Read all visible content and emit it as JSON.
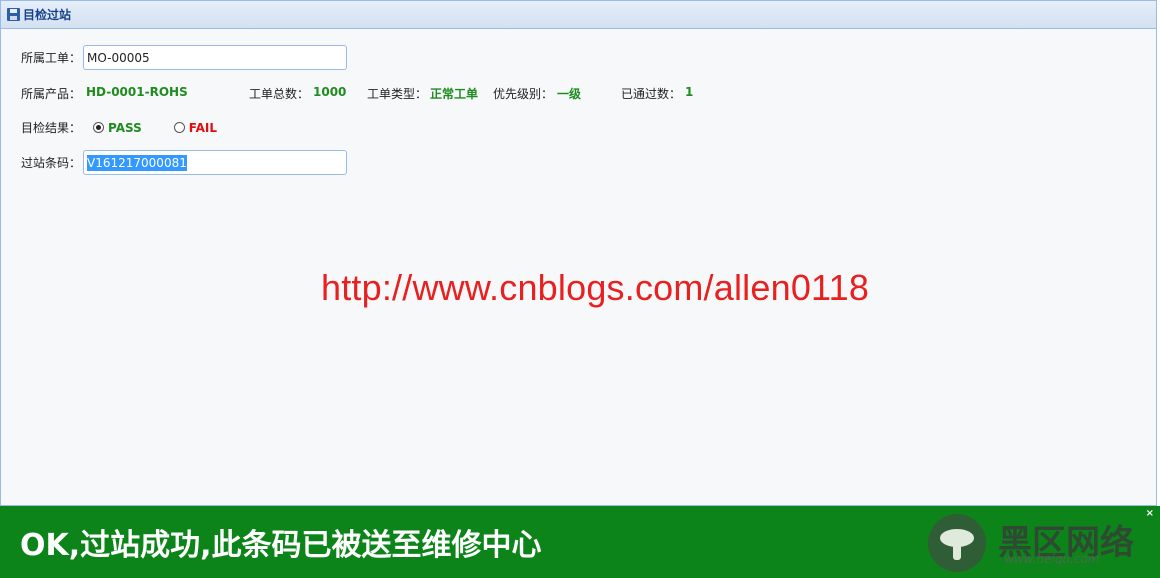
{
  "panel": {
    "title": "目检过站",
    "icon": "save-icon"
  },
  "form": {
    "work_order_label": "所属工单：",
    "work_order_value": "MO-00005",
    "product_label": "所属产品：",
    "product_value": "HD-0001-ROHS",
    "total_label": "工单总数：",
    "total_value": "1000",
    "type_label": "工单类型：",
    "type_value": "正常工单",
    "priority_label": "优先级别：",
    "priority_value": "一级",
    "passed_label": "已通过数：",
    "passed_value": "1",
    "result_label": "目检结果：",
    "pass_label": "PASS",
    "fail_label": "FAIL",
    "pass_checked": true,
    "barcode_label": "过站条码：",
    "barcode_value": "V161217000081"
  },
  "watermark": {
    "url": "http://www.cnblogs.com/allen0118"
  },
  "toast": {
    "message": "OK,过站成功,此条码已被送至维修中心",
    "close": "×"
  },
  "logo": {
    "text": "黑区网络",
    "sub": "www.heiqu.com"
  },
  "colors": {
    "success_green": "#1e8c1e",
    "fail_red": "#e01010",
    "toast_bg": "#0c8419",
    "watermark_red": "#e82020"
  }
}
